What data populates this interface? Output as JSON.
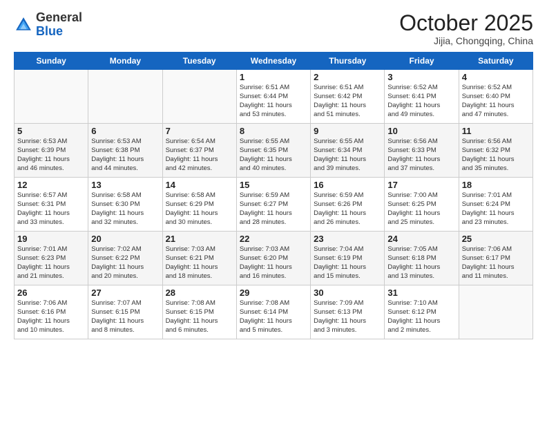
{
  "header": {
    "logo_general": "General",
    "logo_blue": "Blue",
    "month": "October 2025",
    "location": "Jijia, Chongqing, China"
  },
  "days_of_week": [
    "Sunday",
    "Monday",
    "Tuesday",
    "Wednesday",
    "Thursday",
    "Friday",
    "Saturday"
  ],
  "weeks": [
    [
      {
        "day": "",
        "info": ""
      },
      {
        "day": "",
        "info": ""
      },
      {
        "day": "",
        "info": ""
      },
      {
        "day": "1",
        "info": "Sunrise: 6:51 AM\nSunset: 6:44 PM\nDaylight: 11 hours\nand 53 minutes."
      },
      {
        "day": "2",
        "info": "Sunrise: 6:51 AM\nSunset: 6:42 PM\nDaylight: 11 hours\nand 51 minutes."
      },
      {
        "day": "3",
        "info": "Sunrise: 6:52 AM\nSunset: 6:41 PM\nDaylight: 11 hours\nand 49 minutes."
      },
      {
        "day": "4",
        "info": "Sunrise: 6:52 AM\nSunset: 6:40 PM\nDaylight: 11 hours\nand 47 minutes."
      }
    ],
    [
      {
        "day": "5",
        "info": "Sunrise: 6:53 AM\nSunset: 6:39 PM\nDaylight: 11 hours\nand 46 minutes."
      },
      {
        "day": "6",
        "info": "Sunrise: 6:53 AM\nSunset: 6:38 PM\nDaylight: 11 hours\nand 44 minutes."
      },
      {
        "day": "7",
        "info": "Sunrise: 6:54 AM\nSunset: 6:37 PM\nDaylight: 11 hours\nand 42 minutes."
      },
      {
        "day": "8",
        "info": "Sunrise: 6:55 AM\nSunset: 6:35 PM\nDaylight: 11 hours\nand 40 minutes."
      },
      {
        "day": "9",
        "info": "Sunrise: 6:55 AM\nSunset: 6:34 PM\nDaylight: 11 hours\nand 39 minutes."
      },
      {
        "day": "10",
        "info": "Sunrise: 6:56 AM\nSunset: 6:33 PM\nDaylight: 11 hours\nand 37 minutes."
      },
      {
        "day": "11",
        "info": "Sunrise: 6:56 AM\nSunset: 6:32 PM\nDaylight: 11 hours\nand 35 minutes."
      }
    ],
    [
      {
        "day": "12",
        "info": "Sunrise: 6:57 AM\nSunset: 6:31 PM\nDaylight: 11 hours\nand 33 minutes."
      },
      {
        "day": "13",
        "info": "Sunrise: 6:58 AM\nSunset: 6:30 PM\nDaylight: 11 hours\nand 32 minutes."
      },
      {
        "day": "14",
        "info": "Sunrise: 6:58 AM\nSunset: 6:29 PM\nDaylight: 11 hours\nand 30 minutes."
      },
      {
        "day": "15",
        "info": "Sunrise: 6:59 AM\nSunset: 6:27 PM\nDaylight: 11 hours\nand 28 minutes."
      },
      {
        "day": "16",
        "info": "Sunrise: 6:59 AM\nSunset: 6:26 PM\nDaylight: 11 hours\nand 26 minutes."
      },
      {
        "day": "17",
        "info": "Sunrise: 7:00 AM\nSunset: 6:25 PM\nDaylight: 11 hours\nand 25 minutes."
      },
      {
        "day": "18",
        "info": "Sunrise: 7:01 AM\nSunset: 6:24 PM\nDaylight: 11 hours\nand 23 minutes."
      }
    ],
    [
      {
        "day": "19",
        "info": "Sunrise: 7:01 AM\nSunset: 6:23 PM\nDaylight: 11 hours\nand 21 minutes."
      },
      {
        "day": "20",
        "info": "Sunrise: 7:02 AM\nSunset: 6:22 PM\nDaylight: 11 hours\nand 20 minutes."
      },
      {
        "day": "21",
        "info": "Sunrise: 7:03 AM\nSunset: 6:21 PM\nDaylight: 11 hours\nand 18 minutes."
      },
      {
        "day": "22",
        "info": "Sunrise: 7:03 AM\nSunset: 6:20 PM\nDaylight: 11 hours\nand 16 minutes."
      },
      {
        "day": "23",
        "info": "Sunrise: 7:04 AM\nSunset: 6:19 PM\nDaylight: 11 hours\nand 15 minutes."
      },
      {
        "day": "24",
        "info": "Sunrise: 7:05 AM\nSunset: 6:18 PM\nDaylight: 11 hours\nand 13 minutes."
      },
      {
        "day": "25",
        "info": "Sunrise: 7:06 AM\nSunset: 6:17 PM\nDaylight: 11 hours\nand 11 minutes."
      }
    ],
    [
      {
        "day": "26",
        "info": "Sunrise: 7:06 AM\nSunset: 6:16 PM\nDaylight: 11 hours\nand 10 minutes."
      },
      {
        "day": "27",
        "info": "Sunrise: 7:07 AM\nSunset: 6:15 PM\nDaylight: 11 hours\nand 8 minutes."
      },
      {
        "day": "28",
        "info": "Sunrise: 7:08 AM\nSunset: 6:15 PM\nDaylight: 11 hours\nand 6 minutes."
      },
      {
        "day": "29",
        "info": "Sunrise: 7:08 AM\nSunset: 6:14 PM\nDaylight: 11 hours\nand 5 minutes."
      },
      {
        "day": "30",
        "info": "Sunrise: 7:09 AM\nSunset: 6:13 PM\nDaylight: 11 hours\nand 3 minutes."
      },
      {
        "day": "31",
        "info": "Sunrise: 7:10 AM\nSunset: 6:12 PM\nDaylight: 11 hours\nand 2 minutes."
      },
      {
        "day": "",
        "info": ""
      }
    ]
  ]
}
